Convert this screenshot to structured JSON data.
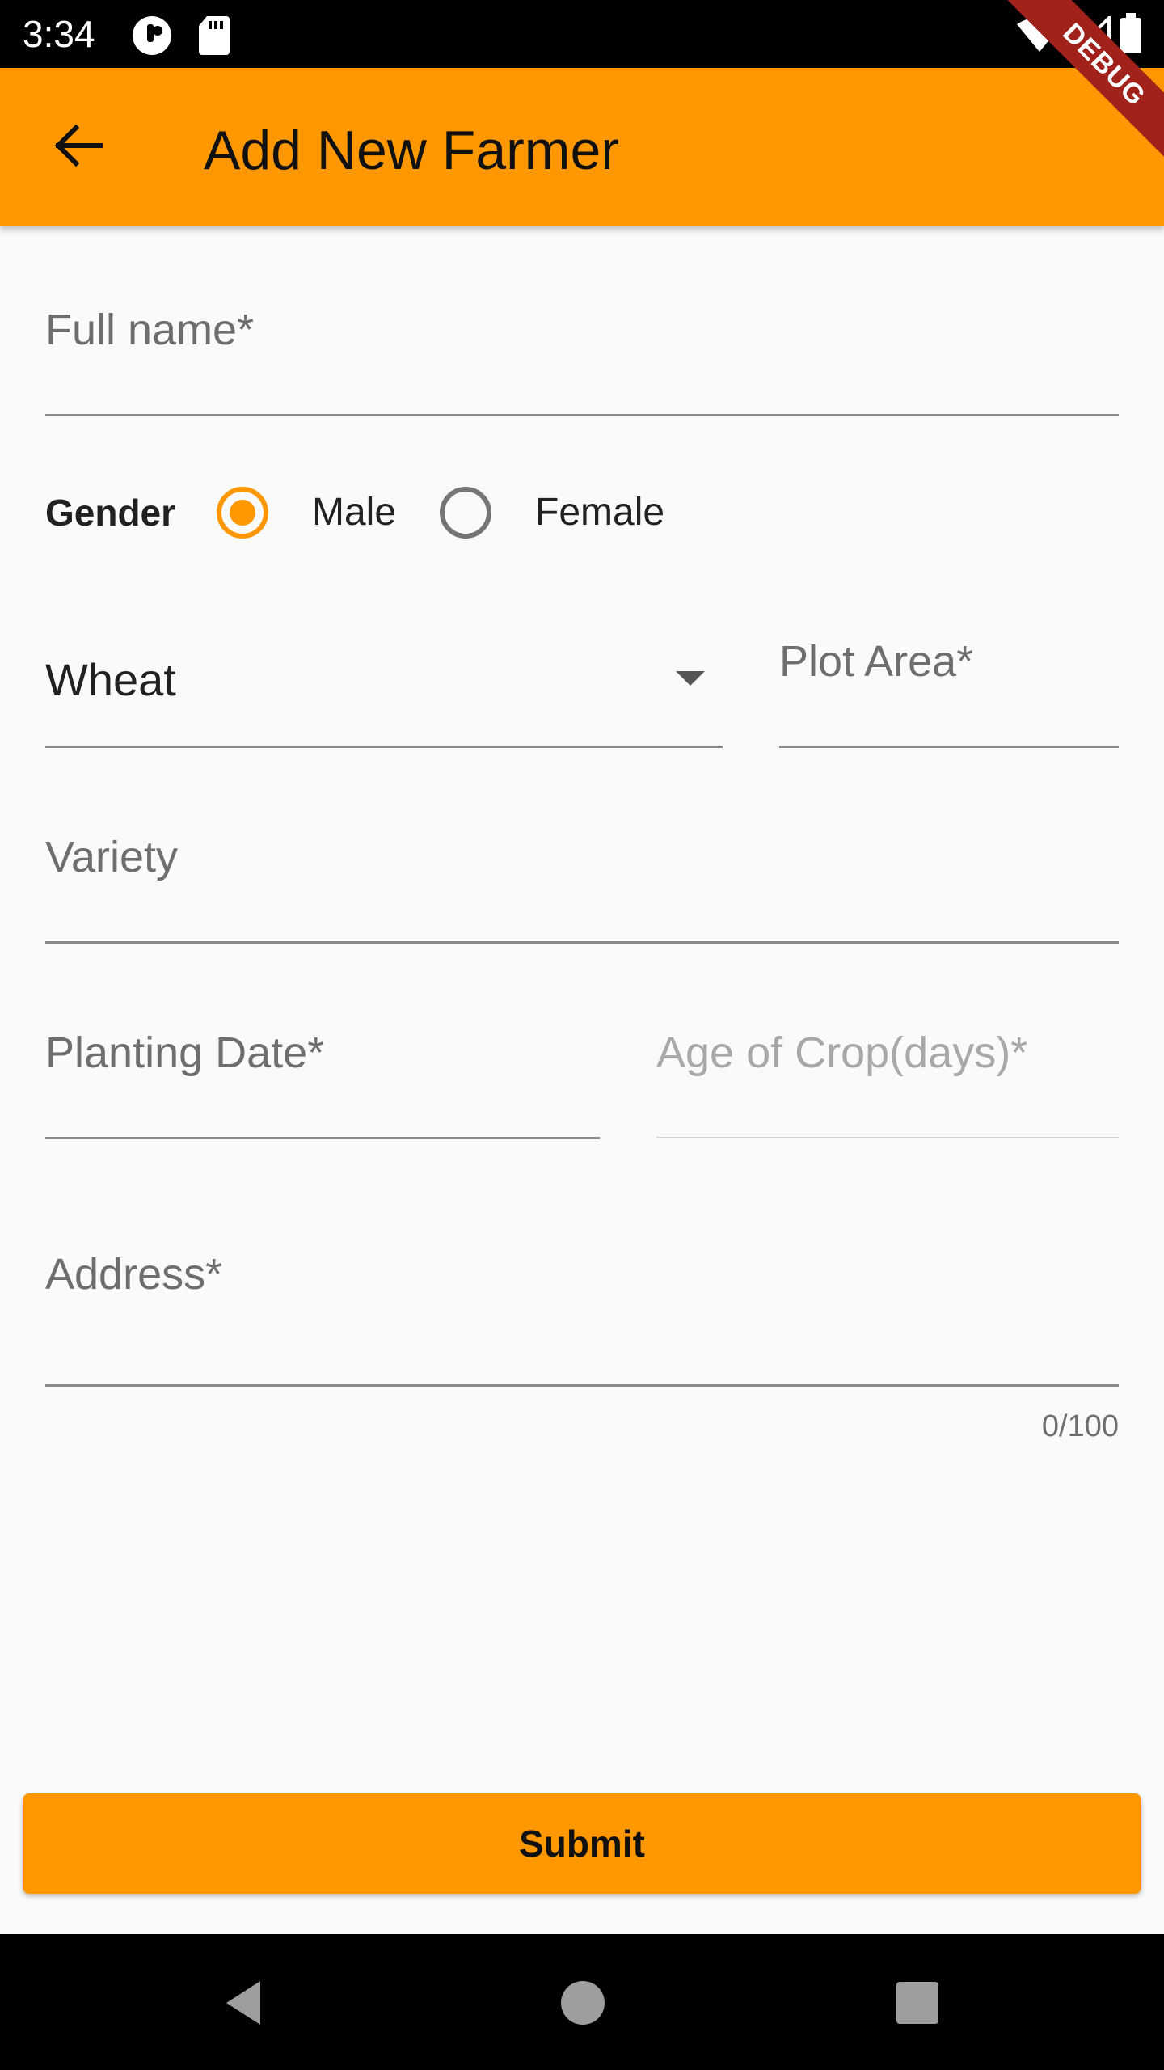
{
  "status_bar": {
    "time": "3:34"
  },
  "app_bar": {
    "title": "Add New Farmer",
    "back_icon": "arrow-back-icon",
    "background": "#ff9800"
  },
  "debug_banner": "DEBUG",
  "form": {
    "full_name": {
      "label": "Full name*",
      "value": ""
    },
    "gender": {
      "label": "Gender",
      "options": [
        "Male",
        "Female"
      ],
      "selected": "Male"
    },
    "crop": {
      "value": "Wheat"
    },
    "plot_area": {
      "label": "Plot Area*",
      "value": ""
    },
    "variety": {
      "label": "Variety",
      "value": ""
    },
    "planting_date": {
      "label": "Planting Date*",
      "value": ""
    },
    "age_of_crop": {
      "label": "Age of Crop(days)*",
      "value": ""
    },
    "address": {
      "label": "Address*",
      "value": "",
      "counter": "0/100"
    }
  },
  "submit": {
    "label": "Submit"
  },
  "colors": {
    "accent": "#ff9800",
    "debug": "#a1211b"
  }
}
